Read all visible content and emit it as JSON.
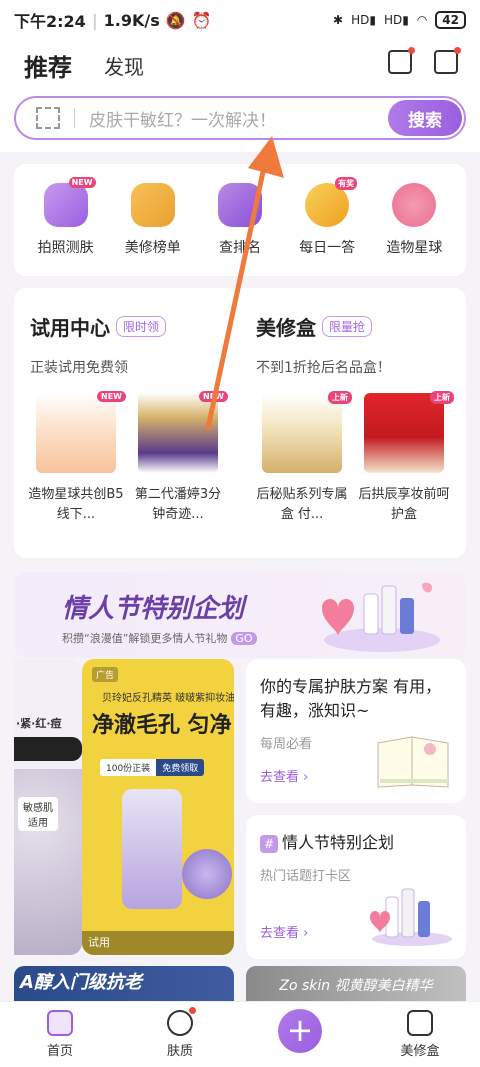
{
  "status": {
    "time": "下午2:24",
    "speed": "1.9K/s",
    "battery": "42",
    "signal1": "HD",
    "signal2": "HD"
  },
  "header": {
    "tab_recommend": "推荐",
    "tab_discover": "发现"
  },
  "search": {
    "placeholder": "皮肤干敏红？一次解决！",
    "button": "搜索"
  },
  "quick": {
    "items": [
      {
        "label": "拍照测肤",
        "badge": "NEW"
      },
      {
        "label": "美修榜单",
        "badge": ""
      },
      {
        "label": "查排名",
        "badge": ""
      },
      {
        "label": "每日一答",
        "badge": "有奖"
      },
      {
        "label": "造物星球",
        "badge": ""
      }
    ]
  },
  "trial": {
    "title": "试用中心",
    "tag": "限时领",
    "sub": "正装试用免费领",
    "products": [
      {
        "name": "造物星球共创B5线下...",
        "badge": "NEW"
      },
      {
        "name": "第二代潘婷3分钟奇迹...",
        "badge": "NEW"
      }
    ]
  },
  "box": {
    "title": "美修盒",
    "tag": "限量抢",
    "sub": "不到1折抢后名品盒！",
    "products": [
      {
        "name": "后秘贴系列专属盒 付...",
        "badge": "上新"
      },
      {
        "name": "后拱辰享妆前呵护盒",
        "badge": "上新"
      }
    ]
  },
  "banner": {
    "title": "情人节特别企划",
    "sub": "积攒“浪漫值”解锁更多情人节礼物",
    "go": "GO"
  },
  "feed": {
    "left_text": "·紧·红·痘",
    "left_tag": "敏感肌适用",
    "ad_label": "广告",
    "ad_headline": "净澈毛孔 匀净",
    "ad_top": "贝玲妃反孔精英 啵啵紫抑妆油",
    "ad_chip1": "100份正装",
    "ad_chip2": "免费领取",
    "ad_bottom": "试用",
    "card1_title": "你的专属护肤方案 有用，有趣，涨知识~",
    "card1_sub": "每周必看",
    "card1_link": "去查看 ›",
    "card2_hash": "#",
    "card2_title": "情人节特别企划",
    "card2_sub": "热门话题打卡区",
    "card2_link": "去查看 ›"
  },
  "strip": {
    "left": "A醇入门级抗老",
    "right": "Zo skin 视黄醇美白精华"
  },
  "tabbar": {
    "home": "首页",
    "skin": "肤质",
    "box": "美修盒"
  },
  "colors": {
    "accent": "#9a5fe0",
    "arrow": "#f07a3c"
  }
}
